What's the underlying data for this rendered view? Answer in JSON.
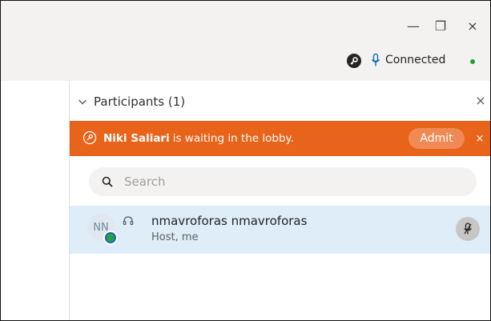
{
  "window": {
    "minimize_label": "—",
    "restore_label": "❐",
    "close_label": "×"
  },
  "status": {
    "connected_label": "Connected",
    "connected_color": "#21a035",
    "icons": [
      "key-icon",
      "mic-icon"
    ]
  },
  "panel": {
    "title": "Participants (1)",
    "close_label": "×"
  },
  "lobby": {
    "name": "Niki Saliari",
    "message": "is waiting in the lobby.",
    "admit_label": "Admit",
    "close_label": "×",
    "color": "#e8641b"
  },
  "search": {
    "placeholder": "Search"
  },
  "participants": [
    {
      "initials": "NN",
      "name": "nmavroforas nmavroforas",
      "role": "Host, me",
      "row_color": "#deedf8"
    }
  ]
}
